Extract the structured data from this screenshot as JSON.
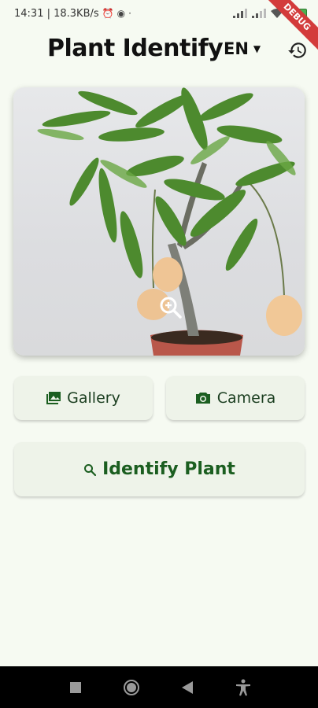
{
  "status_bar": {
    "time_info": "14:31 | 18.3KB/s",
    "debug_banner": "DEBUG"
  },
  "app_bar": {
    "title": "Plant Identify",
    "language": "EN"
  },
  "image_card": {
    "zoom_icon": "zoom-in-icon"
  },
  "actions": {
    "gallery_label": "Gallery",
    "camera_label": "Camera",
    "identify_label": "Identify Plant"
  },
  "colors": {
    "background": "#f6faf2",
    "button_bg": "#eef3e9",
    "accent": "#1b5e20"
  },
  "nav_bar": {
    "items": [
      "recent-apps-icon",
      "home-icon",
      "back-icon",
      "accessibility-icon"
    ]
  }
}
